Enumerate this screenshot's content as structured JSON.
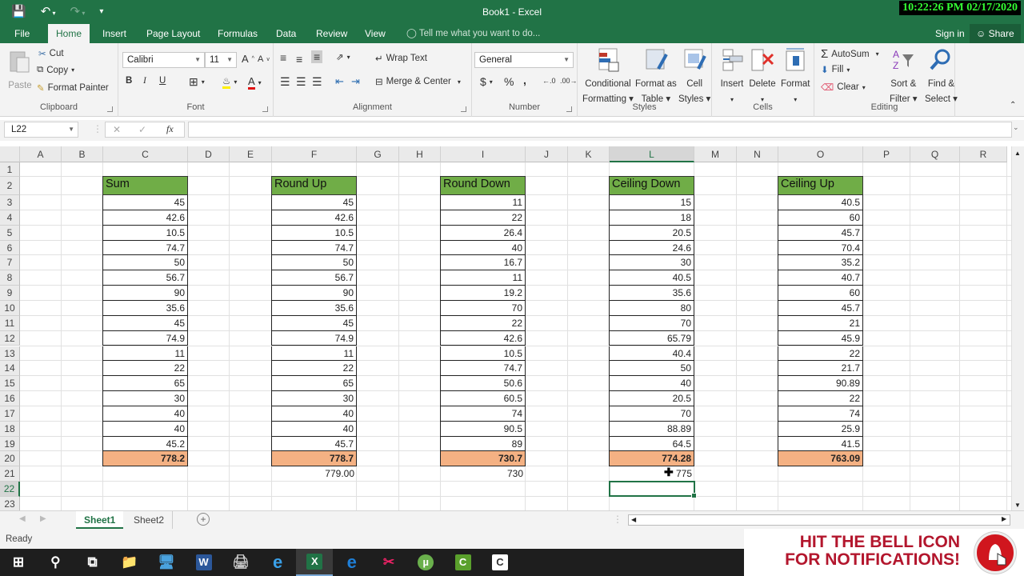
{
  "window": {
    "title": "Book1 - Excel",
    "clock": "10:22:26 PM 02/17/2020"
  },
  "ribbon_tabs": [
    "File",
    "Home",
    "Insert",
    "Page Layout",
    "Formulas",
    "Data",
    "Review",
    "View"
  ],
  "active_tab": "Home",
  "tell_me": "Tell me what you want to do...",
  "account": {
    "sign_in": "Sign in",
    "share": "Share"
  },
  "clipboard": {
    "paste": "Paste",
    "cut": "Cut",
    "copy": "Copy",
    "format_painter": "Format Painter",
    "label": "Clipboard"
  },
  "font": {
    "name": "Calibri",
    "size": "11",
    "bold": "B",
    "italic": "I",
    "underline": "U",
    "label": "Font"
  },
  "alignment": {
    "wrap_text": "Wrap Text",
    "merge_center": "Merge & Center",
    "label": "Alignment"
  },
  "number": {
    "format": "General",
    "currency": "$",
    "percent": "%",
    "comma": ",",
    "label": "Number"
  },
  "styles": {
    "conditional_1": "Conditional",
    "conditional_2": "Formatting",
    "format_table_1": "Format as",
    "format_table_2": "Table",
    "cell_styles_1": "Cell",
    "cell_styles_2": "Styles",
    "label": "Styles"
  },
  "cells": {
    "insert": "Insert",
    "delete": "Delete",
    "format": "Format",
    "label": "Cells"
  },
  "editing": {
    "autosum": "AutoSum",
    "fill": "Fill",
    "clear": "Clear",
    "sort_1": "Sort &",
    "sort_2": "Filter",
    "find_1": "Find &",
    "find_2": "Select",
    "label": "Editing"
  },
  "formula_bar": {
    "name_box": "L22",
    "fx": "fx",
    "formula": ""
  },
  "columns": [
    "A",
    "B",
    "C",
    "D",
    "E",
    "F",
    "G",
    "H",
    "I",
    "J",
    "K",
    "L",
    "M",
    "N",
    "O",
    "P",
    "Q",
    "R"
  ],
  "selected_column": "L",
  "rows": [
    "1",
    "2",
    "3",
    "4",
    "5",
    "6",
    "7",
    "8",
    "9",
    "10",
    "11",
    "12",
    "13",
    "14",
    "15",
    "16",
    "17",
    "18",
    "19",
    "20",
    "21",
    "22",
    "23"
  ],
  "selected_row": "22",
  "tables": [
    {
      "column": "C",
      "header": "Sum",
      "values": [
        "45",
        "42.6",
        "10.5",
        "74.7",
        "50",
        "56.7",
        "90",
        "35.6",
        "45",
        "74.9",
        "11",
        "22",
        "65",
        "30",
        "40",
        "40",
        "45.2"
      ],
      "total": "778.2",
      "below": ""
    },
    {
      "column": "F",
      "header": "Round Up",
      "values": [
        "45",
        "42.6",
        "10.5",
        "74.7",
        "50",
        "56.7",
        "90",
        "35.6",
        "45",
        "74.9",
        "11",
        "22",
        "65",
        "30",
        "40",
        "40",
        "45.7"
      ],
      "total": "778.7",
      "below": "779.00"
    },
    {
      "column": "I",
      "header": "Round Down",
      "values": [
        "11",
        "22",
        "26.4",
        "40",
        "16.7",
        "11",
        "19.2",
        "70",
        "22",
        "42.6",
        "10.5",
        "74.7",
        "50.6",
        "60.5",
        "74",
        "90.5",
        "89"
      ],
      "total": "730.7",
      "below": "730"
    },
    {
      "column": "L",
      "header": "Ceiling Down",
      "values": [
        "15",
        "18",
        "20.5",
        "24.6",
        "30",
        "40.5",
        "35.6",
        "80",
        "70",
        "65.79",
        "40.4",
        "50",
        "40",
        "20.5",
        "70",
        "88.89",
        "64.5"
      ],
      "total": "774.28",
      "below": "775"
    },
    {
      "column": "O",
      "header": "Ceiling Up",
      "values": [
        "40.5",
        "60",
        "45.7",
        "70.4",
        "35.2",
        "40.7",
        "60",
        "45.7",
        "21",
        "45.9",
        "22",
        "21.7",
        "90.89",
        "22",
        "74",
        "25.9",
        "41.5"
      ],
      "total": "763.09",
      "below": ""
    }
  ],
  "sheets": [
    "Sheet1",
    "Sheet2"
  ],
  "active_sheet": "Sheet1",
  "status": "Ready",
  "promo": {
    "line1": "HIT THE BELL ICON",
    "line2": "FOR NOTIFICATIONS!"
  },
  "taskbar": [
    "windows-start",
    "search",
    "task-view",
    "file-explorer",
    "network",
    "word",
    "printer",
    "internet-explorer",
    "excel",
    "edge",
    "snipping-tool",
    "utorrent",
    "camtasia",
    "camtasia-recorder"
  ],
  "taskbar_active": "excel"
}
